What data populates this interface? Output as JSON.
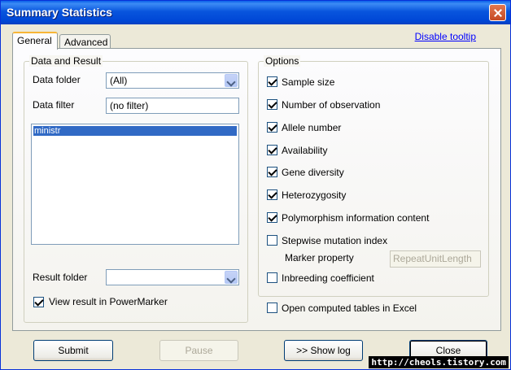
{
  "window": {
    "title": "Summary Statistics"
  },
  "tabs": [
    {
      "label": "General",
      "active": true
    },
    {
      "label": "Advanced",
      "active": false
    }
  ],
  "disable_tooltip_link": "Disable tooltip",
  "data_and_result": {
    "title": "Data and Result",
    "data_folder_label": "Data folder",
    "data_folder_value": "(All)",
    "data_filter_label": "Data filter",
    "data_filter_value": "(no filter)",
    "list_items": [
      "ministr"
    ],
    "result_folder_label": "Result folder",
    "result_folder_value": "",
    "view_result_label": "View result in PowerMarker",
    "view_result_checked": true
  },
  "options": {
    "title": "Options",
    "items": [
      {
        "label": "Sample size",
        "checked": true
      },
      {
        "label": "Number of observation",
        "checked": true
      },
      {
        "label": "Allele number",
        "checked": true
      },
      {
        "label": "Availability",
        "checked": true
      },
      {
        "label": "Gene diversity",
        "checked": true
      },
      {
        "label": "Heterozygosity",
        "checked": true
      },
      {
        "label": "Polymorphism information content",
        "checked": true
      },
      {
        "label": "Stepwise mutation index",
        "checked": false
      },
      {
        "label": "Inbreeding coefficient",
        "checked": false
      }
    ],
    "marker_property_label": "Marker property",
    "marker_property_value": "RepeatUnitLength"
  },
  "open_excel_label": "Open computed tables in Excel",
  "open_excel_checked": false,
  "buttons": {
    "submit": "Submit",
    "pause": "Pause",
    "show_log": ">> Show log",
    "close": "Close"
  },
  "watermark": "http://cheols.tistory.com"
}
